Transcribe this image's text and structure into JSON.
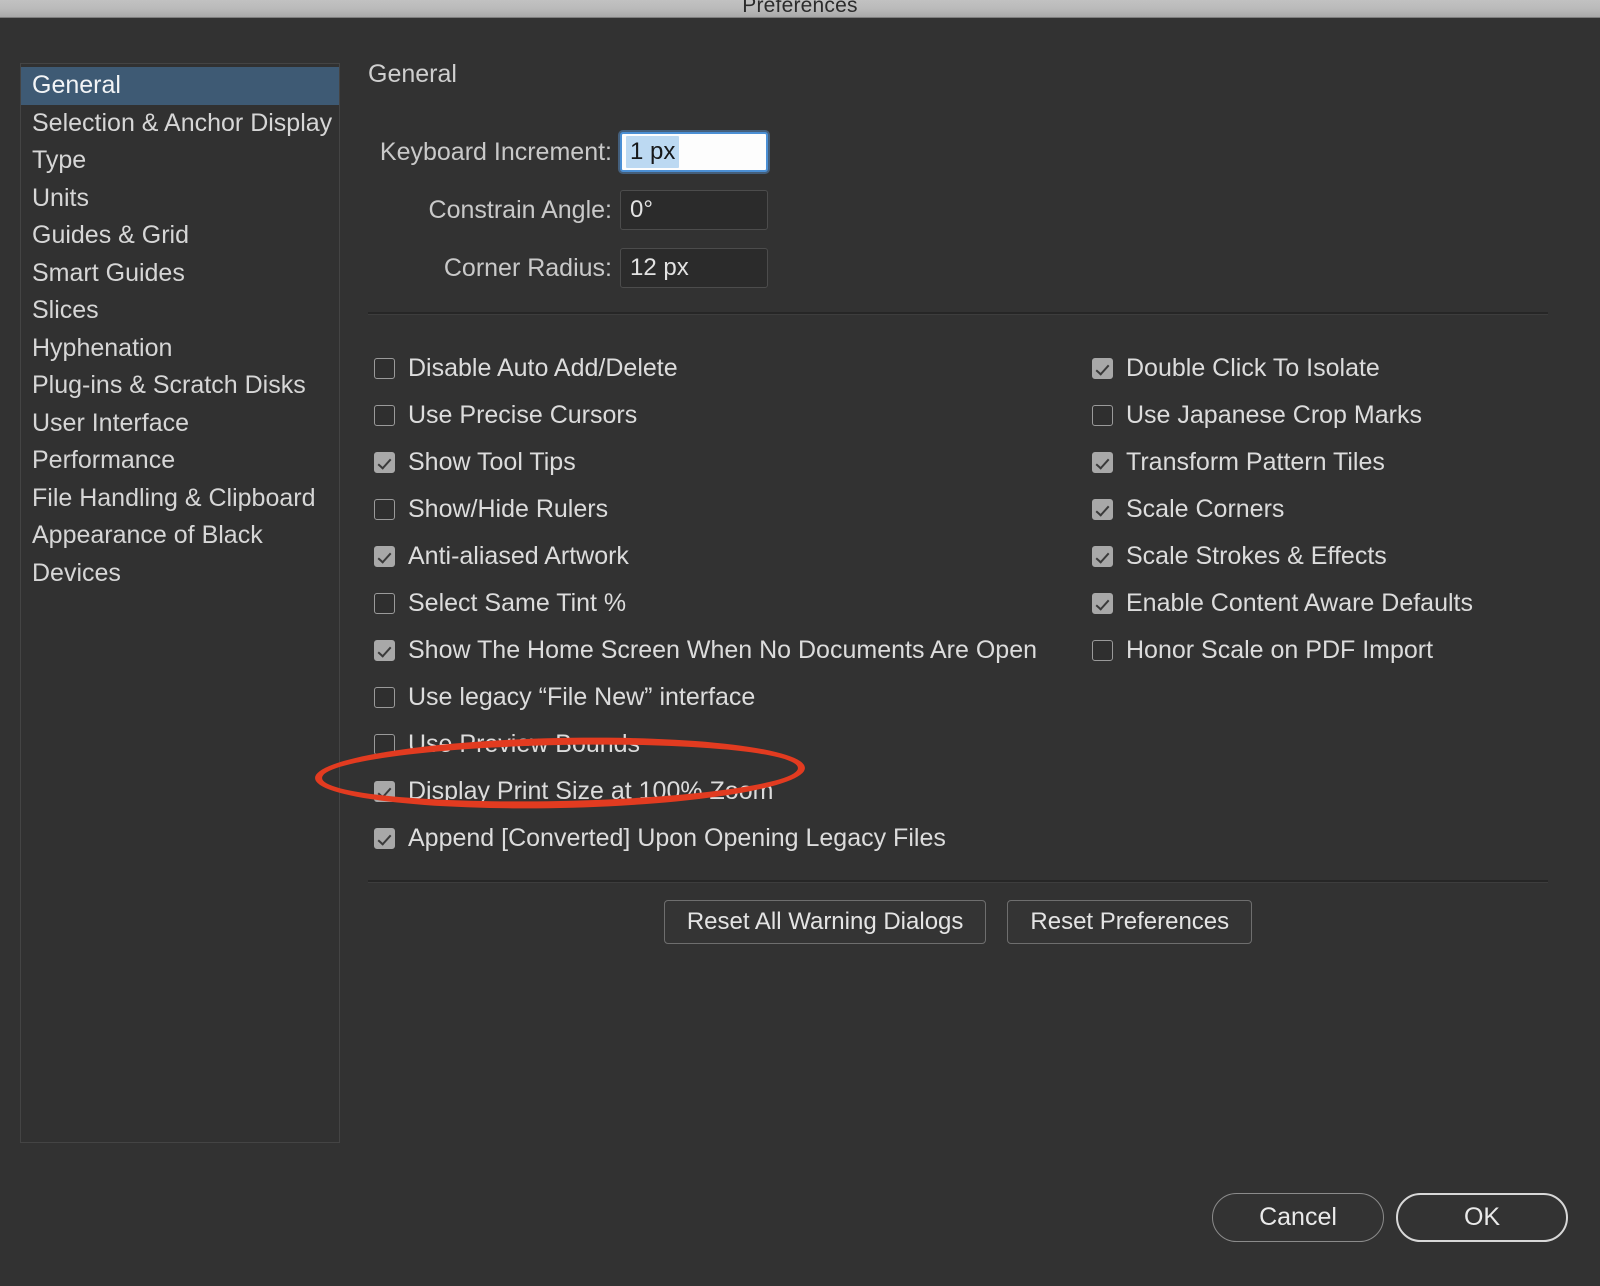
{
  "window": {
    "title": "Preferences"
  },
  "sidebar": {
    "items": [
      {
        "label": "General",
        "selected": true
      },
      {
        "label": "Selection & Anchor Display",
        "selected": false
      },
      {
        "label": "Type",
        "selected": false
      },
      {
        "label": "Units",
        "selected": false
      },
      {
        "label": "Guides & Grid",
        "selected": false
      },
      {
        "label": "Smart Guides",
        "selected": false
      },
      {
        "label": "Slices",
        "selected": false
      },
      {
        "label": "Hyphenation",
        "selected": false
      },
      {
        "label": "Plug-ins & Scratch Disks",
        "selected": false
      },
      {
        "label": "User Interface",
        "selected": false
      },
      {
        "label": "Performance",
        "selected": false
      },
      {
        "label": "File Handling & Clipboard",
        "selected": false
      },
      {
        "label": "Appearance of Black",
        "selected": false
      },
      {
        "label": "Devices",
        "selected": false
      }
    ]
  },
  "main": {
    "panel_title": "General",
    "fields": [
      {
        "label": "Keyboard Increment:",
        "value": "1 px",
        "focused": true,
        "selected_text": "1 px"
      },
      {
        "label": "Constrain Angle:",
        "value": "0°",
        "focused": false
      },
      {
        "label": "Corner Radius:",
        "value": "12 px",
        "focused": false
      }
    ],
    "checkboxes_left": [
      {
        "label": "Disable Auto Add/Delete",
        "checked": false
      },
      {
        "label": "Use Precise Cursors",
        "checked": false
      },
      {
        "label": "Show Tool Tips",
        "checked": true
      },
      {
        "label": "Show/Hide Rulers",
        "checked": false
      },
      {
        "label": "Anti-aliased Artwork",
        "checked": true
      },
      {
        "label": "Select Same Tint %",
        "checked": false
      },
      {
        "label": "Show The Home Screen When No Documents Are Open",
        "checked": true
      },
      {
        "label": "Use legacy “File New” interface",
        "checked": false
      },
      {
        "label": "Use Preview Bounds",
        "checked": false
      },
      {
        "label": "Display Print Size at 100% Zoom",
        "checked": true
      },
      {
        "label": "Append [Converted] Upon Opening Legacy Files",
        "checked": true
      }
    ],
    "checkboxes_right": [
      {
        "label": "Double Click To Isolate",
        "checked": true
      },
      {
        "label": "Use Japanese Crop Marks",
        "checked": false
      },
      {
        "label": "Transform Pattern Tiles",
        "checked": true
      },
      {
        "label": "Scale Corners",
        "checked": true
      },
      {
        "label": "Scale Strokes & Effects",
        "checked": true
      },
      {
        "label": "Enable Content Aware Defaults",
        "checked": true
      },
      {
        "label": "Honor Scale on PDF Import",
        "checked": false
      }
    ],
    "reset_buttons": [
      {
        "label": "Reset All Warning Dialogs"
      },
      {
        "label": "Reset Preferences"
      }
    ]
  },
  "footer": {
    "cancel_label": "Cancel",
    "ok_label": "OK"
  },
  "annotation": {
    "target_label": "Display Print Size at 100% Zoom",
    "color": "#e23b20",
    "shape": "ellipse"
  },
  "colors": {
    "window_background": "#323232",
    "titlebar": "#b9b9b9",
    "sidebar_selection": "#3e5a74",
    "text_primary": "#dcdcdc",
    "field_focus_border": "#4b8fd4",
    "field_selection": "#bcd9f2",
    "annotation_red": "#e23b20"
  }
}
